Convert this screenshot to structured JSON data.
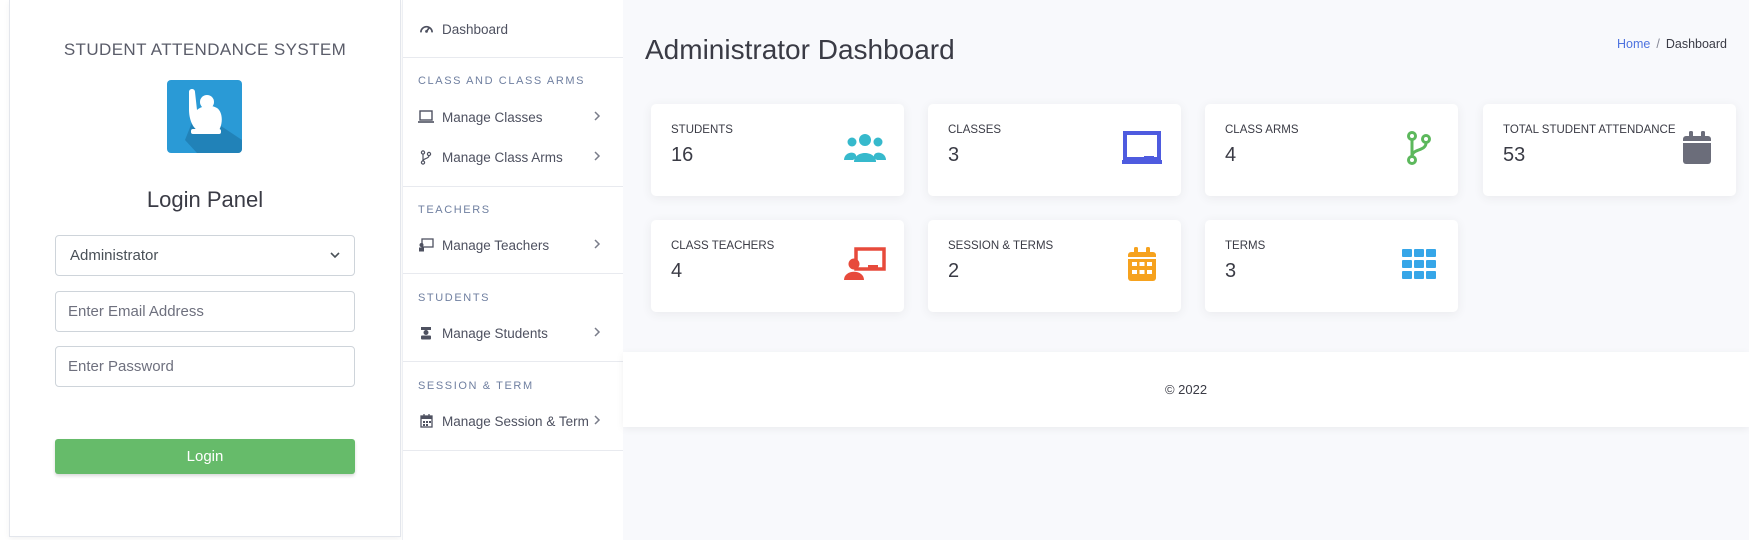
{
  "login": {
    "system_title": "STUDENT ATTENDANCE SYSTEM",
    "panel_title": "Login Panel",
    "role_selected": "Administrator",
    "email_placeholder": "Enter Email Address",
    "password_placeholder": "Enter Password",
    "login_label": "Login",
    "logo_icon": "student-raising-hand-icon",
    "logo_color": "#2a9ad6",
    "button_color": "#66bb6a"
  },
  "sidebar": {
    "dashboard_label": "Dashboard",
    "sections": [
      {
        "heading": "CLASS AND CLASS ARMS",
        "items": [
          {
            "label": "Manage Classes",
            "icon": "laptop-icon"
          },
          {
            "label": "Manage Class Arms",
            "icon": "code-branch-icon"
          }
        ]
      },
      {
        "heading": "TEACHERS",
        "items": [
          {
            "label": "Manage Teachers",
            "icon": "chalkboard-teacher-icon"
          }
        ]
      },
      {
        "heading": "STUDENTS",
        "items": [
          {
            "label": "Manage Students",
            "icon": "user-graduate-icon"
          }
        ]
      },
      {
        "heading": "SESSION & TERM",
        "items": [
          {
            "label": "Manage Session & Term",
            "icon": "calendar-icon"
          }
        ]
      }
    ]
  },
  "main": {
    "title": "Administrator Dashboard",
    "breadcrumb": {
      "home": "Home",
      "separator": "/",
      "current": "Dashboard"
    },
    "cards": [
      {
        "label": "STUDENTS",
        "value": "16",
        "icon": "users-icon",
        "color": "#36b9cc"
      },
      {
        "label": "CLASSES",
        "value": "3",
        "icon": "chalkboard-icon",
        "color": "#4e5bdf"
      },
      {
        "label": "CLASS ARMS",
        "value": "4",
        "icon": "code-branch-icon",
        "color": "#5cb85c"
      },
      {
        "label": "TOTAL STUDENT ATTENDANCE",
        "value": "53",
        "icon": "calendar-icon",
        "color": "#6b6d7a"
      },
      {
        "label": "CLASS TEACHERS",
        "value": "4",
        "icon": "chalkboard-teacher-icon",
        "color": "#e74a3b"
      },
      {
        "label": "SESSION & TERMS",
        "value": "2",
        "icon": "calendar-alt-icon",
        "color": "#f6a21e"
      },
      {
        "label": "TERMS",
        "value": "3",
        "icon": "th-icon",
        "color": "#36a6e8"
      }
    ],
    "footer": "© 2022"
  }
}
